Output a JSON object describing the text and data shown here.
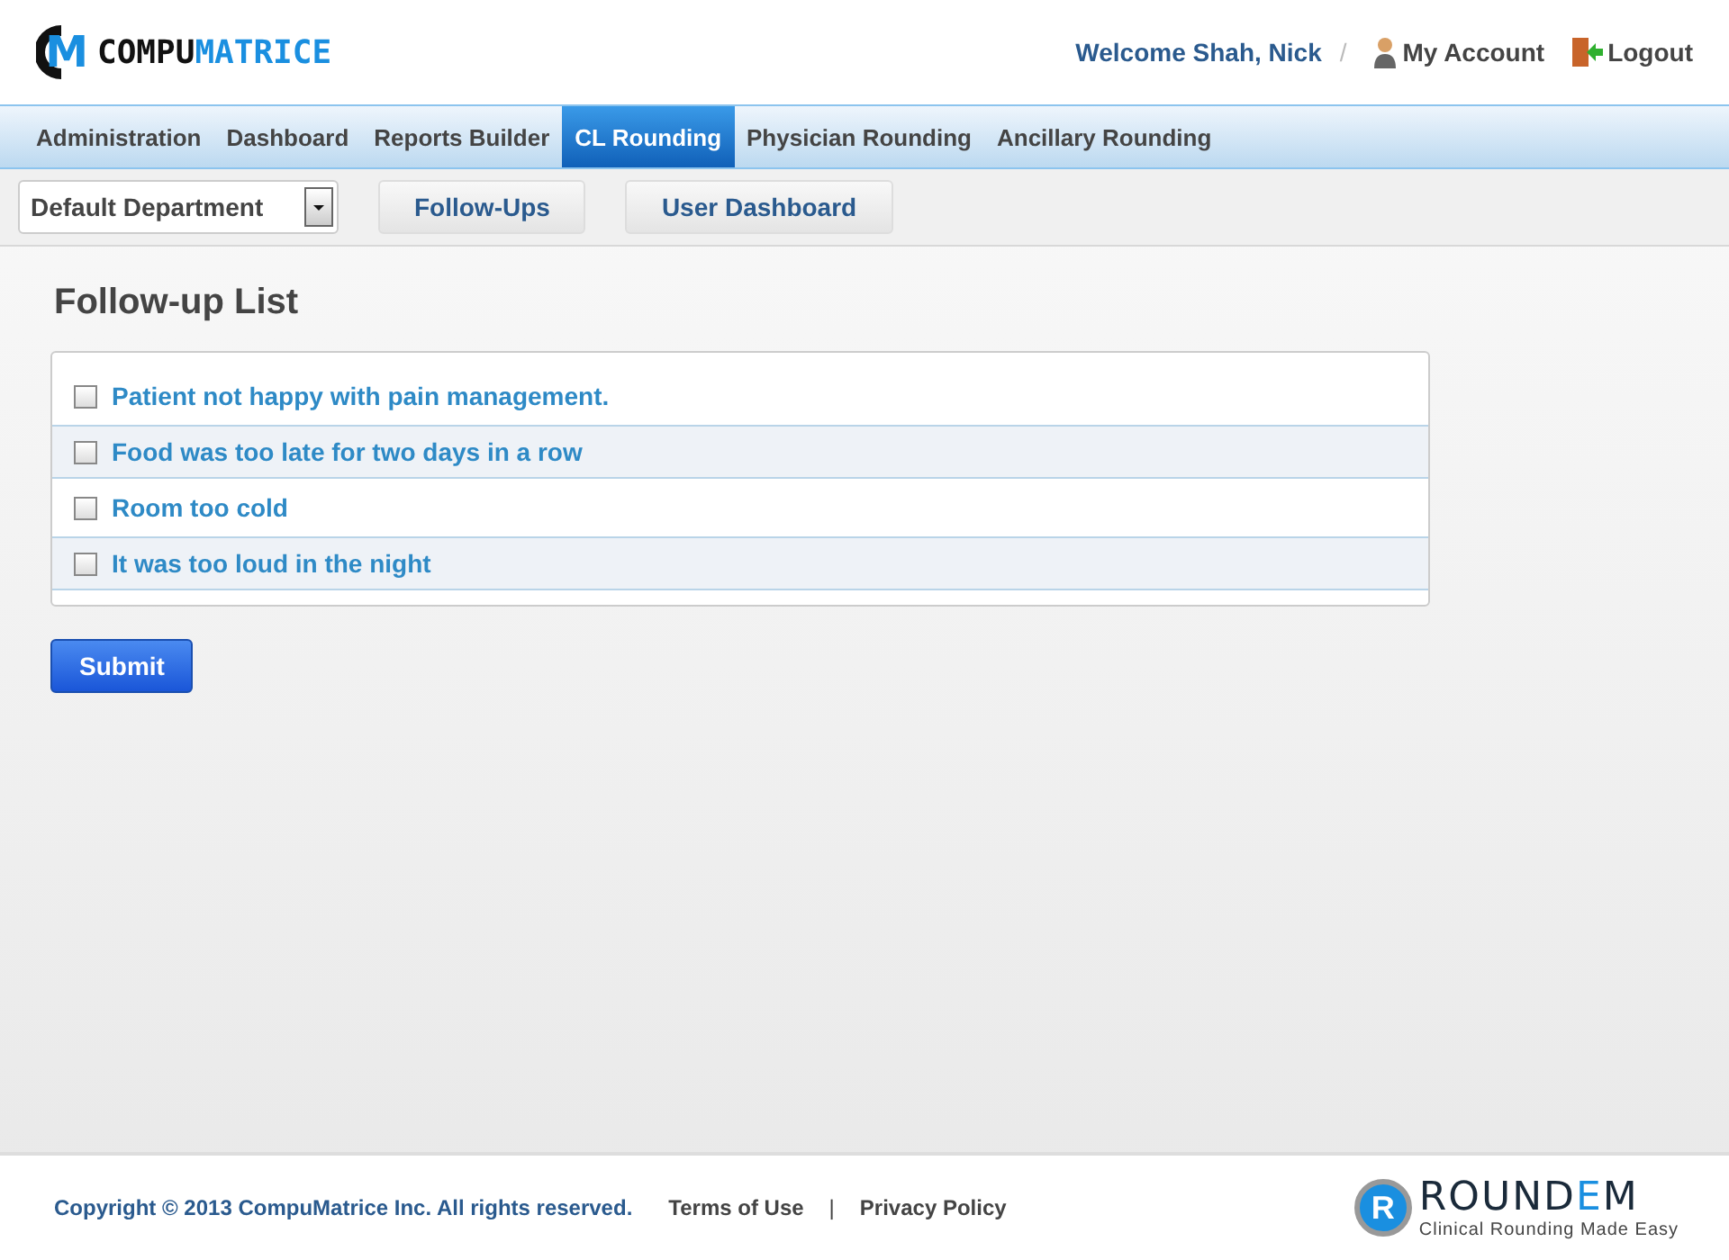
{
  "header": {
    "logo": {
      "mark": "M",
      "parts": [
        {
          "text": "COMPU",
          "color": "#111111"
        },
        {
          "text": "MATRICE",
          "color": "#1a8fe0"
        }
      ]
    },
    "welcome": "Welcome Shah, Nick",
    "separator": "/",
    "links": [
      {
        "kind": "account",
        "label": "My Account"
      },
      {
        "kind": "logout",
        "label": "Logout"
      }
    ]
  },
  "nav": [
    {
      "label": "Administration",
      "selected": false
    },
    {
      "label": "Dashboard",
      "selected": false
    },
    {
      "label": "Reports Builder",
      "selected": false
    },
    {
      "label": "CL Rounding",
      "selected": true
    },
    {
      "label": "Physician Rounding",
      "selected": false
    },
    {
      "label": "Ancillary Rounding",
      "selected": false
    }
  ],
  "toolbar": {
    "department": "Default Department",
    "buttons": [
      "Follow-Ups",
      "User Dashboard"
    ]
  },
  "title": "Follow-up List",
  "items": [
    {
      "label": "Patient not happy with pain management.",
      "checked": false
    },
    {
      "label": "Food was too late for two days in a row",
      "checked": false
    },
    {
      "label": "Room too cold",
      "checked": false
    },
    {
      "label": "It was too loud in the night",
      "checked": false
    }
  ],
  "submit": "Submit",
  "footer": {
    "copyright": "Copyright © 2013 CompuMatrice Inc. All rights reserved.",
    "links": [
      "Terms of Use",
      "Privacy Policy"
    ],
    "divider": "|",
    "brand": {
      "mark": "R",
      "parts": [
        {
          "text": "ROUND",
          "color": "#1a2a3a"
        },
        {
          "text": "E",
          "color": "#1a8fe0"
        },
        {
          "text": "M",
          "color": "#1a2a3a"
        }
      ],
      "tagline": "Clinical Rounding Made Easy"
    }
  }
}
